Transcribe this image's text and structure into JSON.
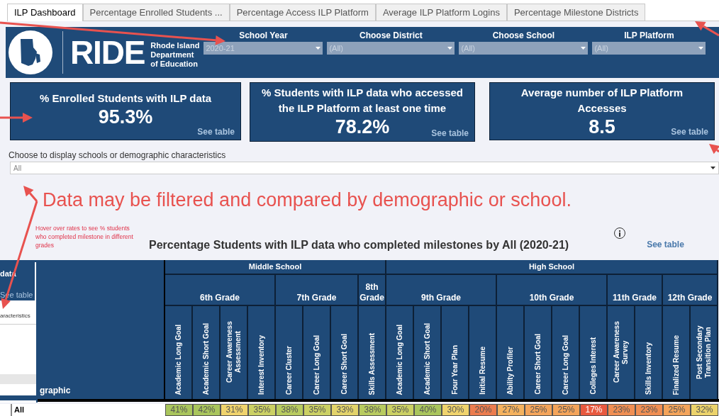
{
  "tabs": [
    {
      "label": "ILP Dashboard",
      "selected": true
    },
    {
      "label": "Percentage Enrolled Students ...",
      "selected": false
    },
    {
      "label": "Percentage Access ILP Platform",
      "selected": false
    },
    {
      "label": "Average ILP Platform Logins",
      "selected": false
    },
    {
      "label": "Percentage Milestone Districts",
      "selected": false
    }
  ],
  "header": {
    "logo_text": "RIDE",
    "org_name_lines": [
      "Rhode Island",
      "Department",
      "of Education"
    ]
  },
  "filters": [
    {
      "label": "School Year",
      "value": "2020-21"
    },
    {
      "label": "Choose District",
      "value": "(All)"
    },
    {
      "label": "Choose School",
      "value": "(All)"
    },
    {
      "label": "ILP Platform",
      "value": "(All)"
    }
  ],
  "kpis": [
    {
      "title": "% Enrolled Students with ILP data",
      "value": "95.3%",
      "link": "See table"
    },
    {
      "title": "% Students with ILP data who accessed the ILP Platform at least one time",
      "value": "78.2%",
      "link": "See table"
    },
    {
      "title": "Average number of ILP Platform Accesses",
      "value": "8.5",
      "link": "See table"
    }
  ],
  "display_filter": {
    "label": "Choose to display schools or demographic characteristics",
    "value": "All"
  },
  "annotation": "Data may be filtered and compared by demographic or school.",
  "hover_note": "Hover over rates to see % students who completed milestone in different grades",
  "chart": {
    "title": "Percentage Students with ILP data who completed milestones by All (2020-21)",
    "see_table": "See table",
    "left_header": "graphic",
    "row_label": "All",
    "groups": [
      {
        "label": "Middle School",
        "grades": [
          {
            "label": "6th Grade",
            "columns": [
              {
                "label": "Academic Long Goal",
                "value": "41%",
                "color": "#a9c55c"
              },
              {
                "label": "Academic Short Goal",
                "value": "42%",
                "color": "#a9c55c"
              },
              {
                "label": "Career Awareness Assessment",
                "value": "31%",
                "color": "#f0d36c"
              },
              {
                "label": "Interest Inventory",
                "value": "35%",
                "color": "#cbd063"
              }
            ]
          },
          {
            "label": "7th Grade",
            "columns": [
              {
                "label": "Career Cluster",
                "value": "38%",
                "color": "#b8cb5f"
              },
              {
                "label": "Career Long Goal",
                "value": "35%",
                "color": "#cbd063"
              },
              {
                "label": "Career Short Goal",
                "value": "33%",
                "color": "#e3d36a"
              }
            ]
          },
          {
            "label": "8th Grade",
            "columns": [
              {
                "label": "Skills Assessment",
                "value": "38%",
                "color": "#b8cb5f"
              }
            ]
          }
        ]
      },
      {
        "label": "High School",
        "grades": [
          {
            "label": "9th Grade",
            "columns": [
              {
                "label": "Academic Long Goal",
                "value": "35%",
                "color": "#cbd063"
              },
              {
                "label": "Academic Short Goal",
                "value": "40%",
                "color": "#a9c55c"
              },
              {
                "label": "Four Year Plan",
                "value": "30%",
                "color": "#f0d36c"
              },
              {
                "label": "Initial Resume",
                "value": "20%",
                "color": "#ec7c4e"
              }
            ]
          },
          {
            "label": "10th Grade",
            "columns": [
              {
                "label": "Ability Profiler",
                "value": "27%",
                "color": "#f5b25e"
              },
              {
                "label": "Career Short Goal",
                "value": "25%",
                "color": "#f4a45a"
              },
              {
                "label": "Career Long Goal",
                "value": "25%",
                "color": "#f4a45a"
              },
              {
                "label": "Colleges Interest",
                "value": "17%",
                "color": "#e8593f"
              }
            ]
          },
          {
            "label": "11th Grade",
            "columns": [
              {
                "label": "Career Awareness Survey",
                "value": "23%",
                "color": "#f08e52"
              },
              {
                "label": "Skills Inventory",
                "value": "23%",
                "color": "#f08e52"
              }
            ]
          },
          {
            "label": "12th Grade",
            "columns": [
              {
                "label": "Finalized Resume",
                "value": "25%",
                "color": "#f4a45a"
              },
              {
                "label": "Post Secondary Transition Plan",
                "value": "32%",
                "color": "#ecd36b"
              }
            ]
          }
        ]
      }
    ]
  },
  "inset": {
    "card_title": "data",
    "link": "See table",
    "label": "aracteristics"
  }
}
